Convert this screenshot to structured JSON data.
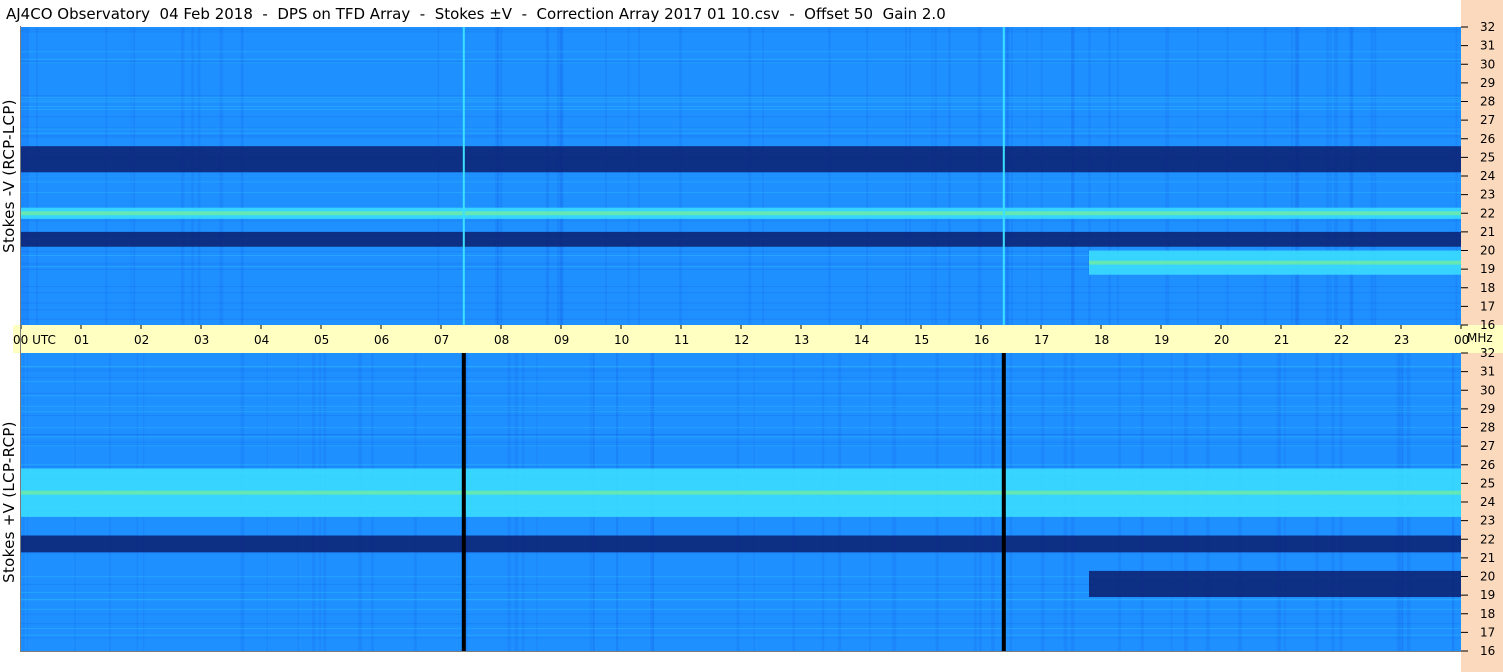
{
  "title": "AJ4CO Observatory  04 Feb 2018  -  DPS on TFD Array  -  Stokes ±V  -  Correction Array 2017 01 10.csv  -  Offset 50  Gain 2.0",
  "panels": {
    "top_ylabel": "Stokes -V (RCP-LCP)",
    "bottom_ylabel": "Stokes +V (LCP-RCP)"
  },
  "colors": {
    "axis_band": "#ffffc2",
    "right_strip": "#fbd9bd",
    "low": "#0b1f6e",
    "mid": "#1461e6",
    "base": "#1e90ff",
    "high": "#3ce0ff",
    "peak": "#9cff5c"
  },
  "chart_data": {
    "type": "heatmap",
    "title": "AJ4CO Observatory  04 Feb 2018  -  DPS on TFD Array  -  Stokes ±V  -  Correction Array 2017 01 10.csv  -  Offset 50  Gain 2.0",
    "x_axis": {
      "labels": [
        "00",
        "01",
        "02",
        "03",
        "04",
        "05",
        "06",
        "07",
        "08",
        "09",
        "10",
        "11",
        "12",
        "13",
        "14",
        "15",
        "16",
        "17",
        "18",
        "19",
        "20",
        "21",
        "22",
        "23",
        "00"
      ],
      "first_label": "00  UTC",
      "unit_label": "UTC",
      "range_hours": [
        0,
        24
      ]
    },
    "y_axis": {
      "unit": "MHz",
      "ticks": [
        "32",
        "31",
        "30",
        "29",
        "28",
        "27",
        "26",
        "25",
        "24",
        "23",
        "22",
        "21",
        "20",
        "19",
        "18",
        "17",
        "16"
      ],
      "range_mhz": [
        16,
        32
      ]
    },
    "panels": [
      {
        "name": "Stokes -V (RCP-LCP)",
        "bands": [
          {
            "mhz": [
              24.2,
              25.6
            ],
            "level": "low"
          },
          {
            "mhz": [
              21.7,
              22.3
            ],
            "level": "high"
          },
          {
            "mhz": [
              20.2,
              21.0
            ],
            "level": "low"
          },
          {
            "mhz": [
              18.7,
              20.0
            ],
            "level": "high",
            "hours": [
              17.8,
              24
            ]
          }
        ],
        "vertical_lines_utc": [
          7.38,
          16.38
        ],
        "vertical_line_level": "high"
      },
      {
        "name": "Stokes +V (LCP-RCP)",
        "bands": [
          {
            "mhz": [
              23.2,
              25.8
            ],
            "level": "high"
          },
          {
            "mhz": [
              21.3,
              22.2
            ],
            "level": "low"
          },
          {
            "mhz": [
              18.9,
              20.3
            ],
            "level": "low",
            "hours": [
              17.8,
              24
            ]
          }
        ],
        "vertical_lines_utc": [
          7.38,
          16.38
        ],
        "vertical_line_level": "black"
      }
    ]
  }
}
